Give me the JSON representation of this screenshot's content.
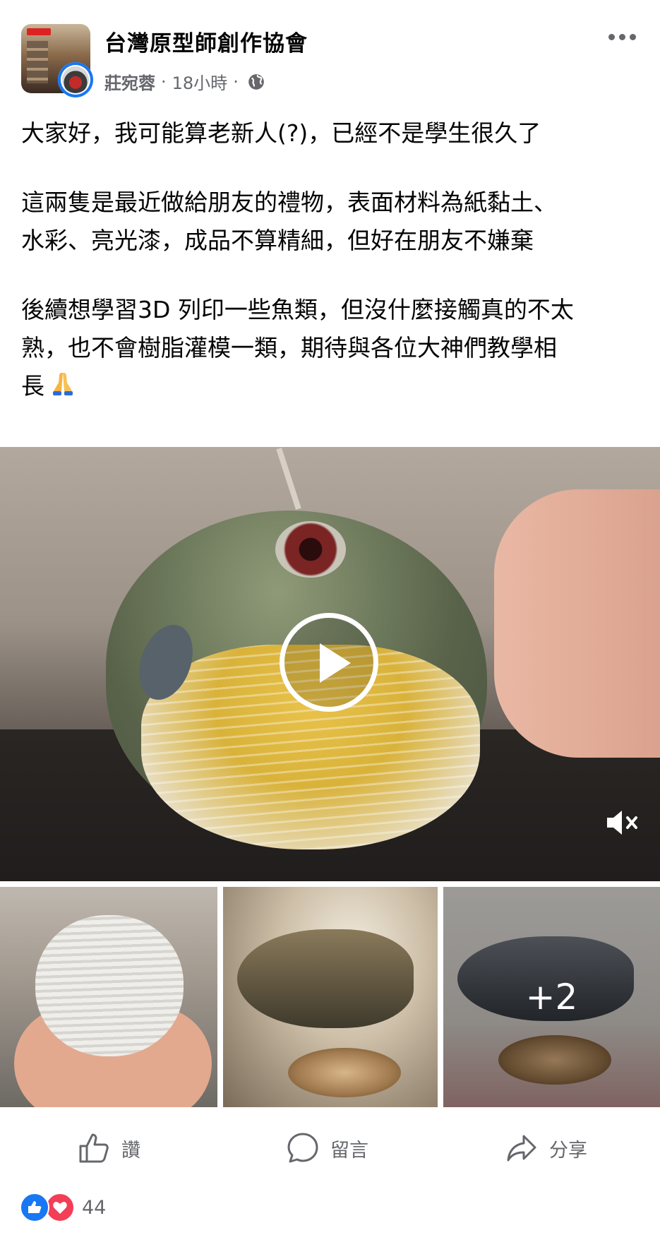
{
  "header": {
    "page_name": "台灣原型師創作協會",
    "author": "莊宛蓉",
    "time": "18小時",
    "separator": "·"
  },
  "post": {
    "paragraph1": "大家好，我可能算老新人(?)，已經不是學生很久了",
    "paragraph2_line1": "這兩隻是最近做給朋友的禮物，表面材料為紙黏土、",
    "paragraph2_line2": "水彩、亮光漆，成品不算精細，但好在朋友不嫌棄",
    "paragraph3_line1": "後續想學習3D 列印一些魚類，但沒什麼接觸真的不太",
    "paragraph3_line2": "熟，也不會樹脂灌模一類，期待與各位大神們教學相",
    "paragraph3_line3": "長",
    "emoji": "pray-emoji"
  },
  "media": {
    "more_count": "+2",
    "icons": {
      "play": "play-icon",
      "mute": "muted-speaker-icon"
    }
  },
  "actions": {
    "like_label": "讚",
    "comment_label": "留言",
    "share_label": "分享"
  },
  "reactions": {
    "count": "44",
    "types": [
      "like",
      "love"
    ]
  },
  "colors": {
    "accent": "#1877f2",
    "love": "#f33e58",
    "secondary_text": "#65676b"
  }
}
